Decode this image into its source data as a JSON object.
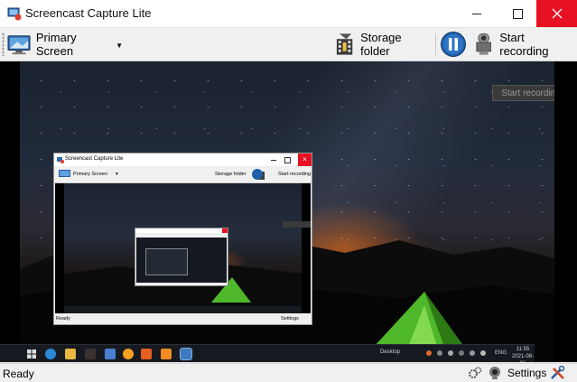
{
  "window": {
    "title": "Screencast Capture Lite",
    "icon": "screencast-app-icon",
    "controls": [
      "minimize-icon",
      "maximize-icon",
      "close-icon"
    ],
    "close_color": "#e81123"
  },
  "toolbar": {
    "screen_selector": {
      "label": "Primary Screen",
      "icon": "monitor-icon"
    },
    "storage_folder": {
      "label": "Storage folder",
      "icon": "film-folder-icon"
    },
    "pause": {
      "icon": "pause-icon",
      "color": "#1f5fa8"
    },
    "start_recording": {
      "label": "Start recording",
      "icon": "camera-record-icon"
    }
  },
  "preview": {
    "overlay_record_label": "Start recording",
    "nested_window": {
      "title": "Screencast Capture Lite",
      "screen_label": "Primary Screen",
      "storage_label": "Storage folder",
      "record_label": "Start recording",
      "status": "Ready",
      "settings_label": "Settings"
    },
    "taskbar": {
      "desktop_label": "Desktop",
      "language": "ENG",
      "time": "11:55",
      "date": "2021-08-06"
    }
  },
  "statusbar": {
    "status": "Ready",
    "settings_label": "Settings",
    "icons": [
      "cpu-gears-icon",
      "webcam-icon",
      "tools-icon"
    ]
  }
}
